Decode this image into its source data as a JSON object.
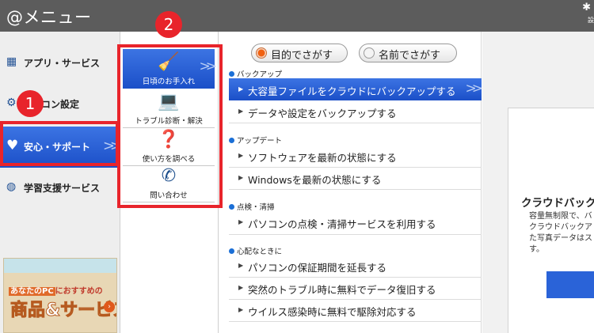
{
  "window": {
    "title": "@メニュー",
    "settings_label": "設"
  },
  "sidebar": {
    "items": [
      {
        "label": "アプリ・サービス",
        "icon": "grid-icon"
      },
      {
        "label": "コン設定",
        "icon": "gear-icon"
      },
      {
        "label": "安心・サポート",
        "icon": "heart-icon",
        "active": true
      },
      {
        "label": "学習支援サービス",
        "icon": "globe-icon"
      }
    ],
    "banner": {
      "line1_highlight": "あなたのPC",
      "line1_rest": "におすすめの",
      "line2": "商品&サービス"
    }
  },
  "submenu": {
    "items": [
      {
        "label": "日頃のお手入れ",
        "icon": "broom-icon",
        "active": true
      },
      {
        "label": "トラブル診断・解決",
        "icon": "pc-diagnose-icon"
      },
      {
        "label": "使い方を調べる",
        "icon": "question-doc-icon"
      },
      {
        "label": "問い合わせ",
        "icon": "phone-icon"
      }
    ]
  },
  "search_mode": {
    "by_purpose": "目的でさがす",
    "by_name": "名前でさがす",
    "selected": "by_purpose"
  },
  "sections": [
    {
      "heading": "バックアップ",
      "items": [
        "大容量ファイルをクラウドにバックアップする",
        "データや設定をバックアップする"
      ]
    },
    {
      "heading": "アップデート",
      "items": [
        "ソフトウェアを最新の状態にする",
        "Windowsを最新の状態にする"
      ]
    },
    {
      "heading": "点検・清掃",
      "items": [
        "パソコンの点検・清掃サービスを利用する"
      ]
    },
    {
      "heading": "心配なときに",
      "items": [
        "パソコンの保証期間を延長する",
        "突然のトラブル時に無料でデータ復旧する",
        "ウイルス感染時に無料で駆除対応する"
      ]
    }
  ],
  "detail_card": {
    "title": "クラウドバック",
    "description": "容量無制限で、バ\nクラウドバックア\nた写真データはス\nす。"
  },
  "annotations": {
    "badge1": "1",
    "badge2": "2",
    "color": "#e8242b"
  }
}
